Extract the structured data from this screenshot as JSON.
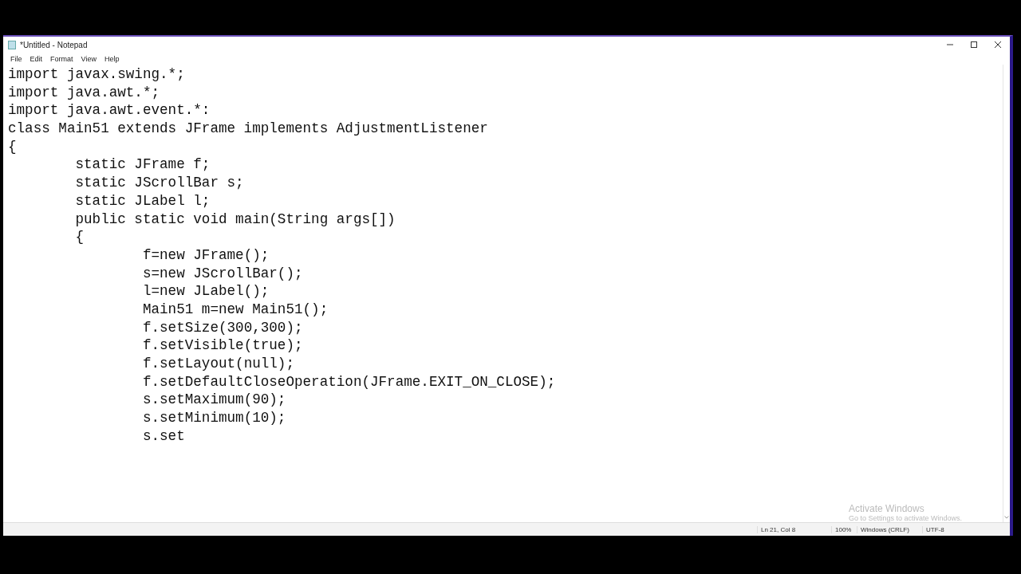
{
  "window": {
    "title": "*Untitled - Notepad"
  },
  "menu": [
    "File",
    "Edit",
    "Format",
    "View",
    "Help"
  ],
  "editor": {
    "lines": [
      "import javax.swing.*;",
      "import java.awt.*;",
      "import java.awt.event.*:",
      "class Main51 extends JFrame implements AdjustmentListener",
      "{",
      "\tstatic JFrame f;",
      "\tstatic JScrollBar s;",
      "\tstatic JLabel l;",
      "\tpublic static void main(String args[])",
      "\t{",
      "\t\tf=new JFrame();",
      "\t\ts=new JScrollBar();",
      "\t\tl=new JLabel();",
      "\t\tMain51 m=new Main51();",
      "\t\tf.setSize(300,300);",
      "\t\tf.setVisible(true);",
      "\t\tf.setLayout(null);",
      "\t\tf.setDefaultCloseOperation(JFrame.EXIT_ON_CLOSE);",
      "\t\ts.setMaximum(90);",
      "\t\ts.setMinimum(10);",
      "\t\ts.set"
    ]
  },
  "activation_notice": {
    "title": "Activate Windows",
    "message": "Go to Settings to activate Windows."
  },
  "status_bar": [
    "Ln 21, Col 8",
    "100%",
    "Windows (CRLF)",
    "UTF-8"
  ]
}
